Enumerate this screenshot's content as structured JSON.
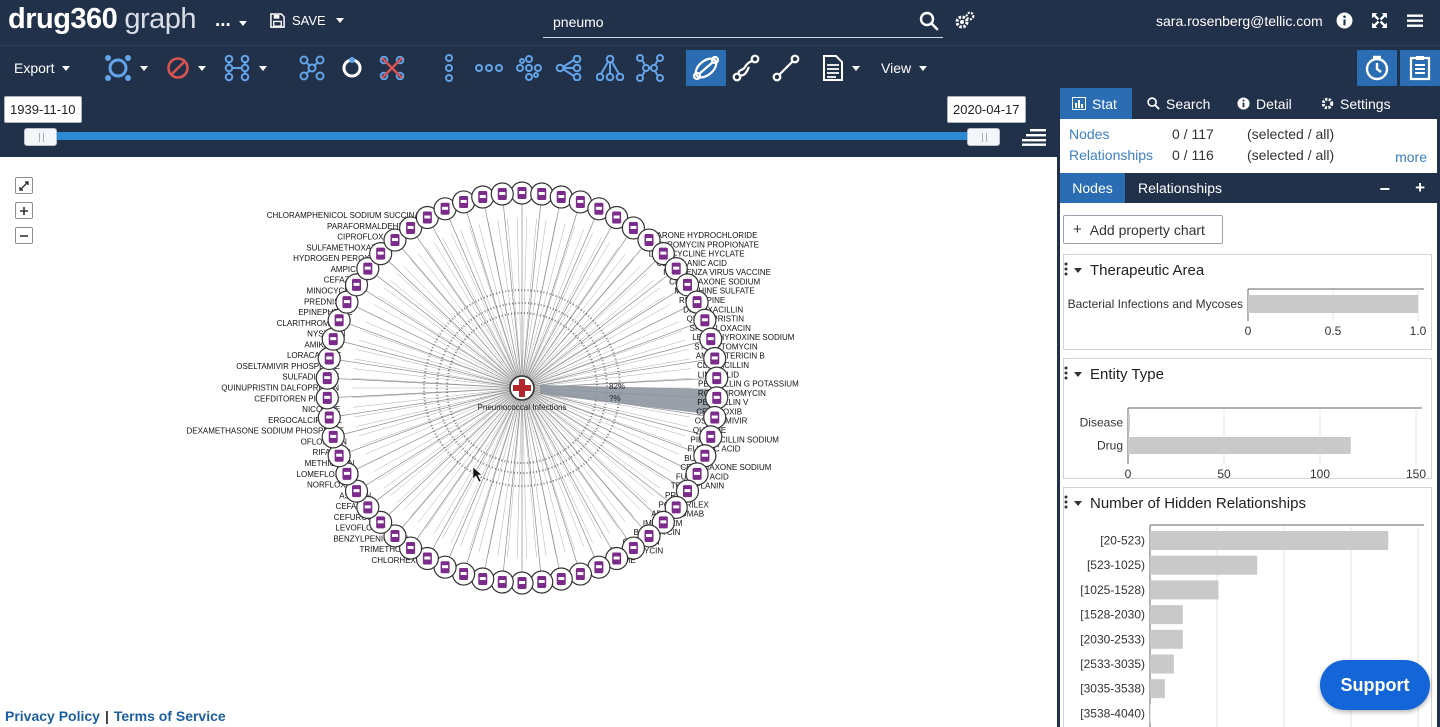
{
  "app": {
    "logo_bold": "drug360",
    "logo_light": "graph",
    "dots": "...",
    "save_label": "SAVE",
    "search_value": "pneumo",
    "user_email": "sara.rosenberg@tellic.com"
  },
  "toolbar": {
    "export_label": "Export",
    "view_label": "View",
    "icons": [
      "layout-icon",
      "block-icon",
      "hierarchy-icon",
      "cluster-icon",
      "circle-layout-icon",
      "remove-icon",
      "vertical-layout-icon",
      "horizontal-layout-icon",
      "grid-layout-icon",
      "radial-icon",
      "tree-icon",
      "spread-icon",
      "paths-icon",
      "expand-path-icon",
      "link-icon",
      "document-icon"
    ],
    "colors": {
      "bar": "#22314a",
      "active": "#2b6db3",
      "danger": "#d9534f",
      "icon": "#63a4e8"
    }
  },
  "timeline": {
    "start_date": "1939-11-10",
    "end_date": "2020-04-17"
  },
  "graph": {
    "center_label": "Pneumococcal Infections",
    "percent_labels": [
      "82%",
      "?%"
    ],
    "node_color": "#7b2b8a",
    "drug_labels_left": [
      "CHLORAMPHENICOL SODIUM SUCCINATE",
      "PARAFORMALDEHYDE",
      "CIPROFLOXACIN",
      "SULFAMETHOXAZOLE",
      "HYDROGEN PEROXIDE",
      "AMPICILLIN",
      "CEFAZOLIN",
      "MINOCYCLINE",
      "PREDNISONE",
      "EPINEPHRINE",
      "CLARITHROMYCIN",
      "NYSTATIN",
      "AMIKACIN",
      "LORACARBEF",
      "OSELTAMIVIR PHOSPHATE",
      "SULFADIAZINE",
      "QUINUPRISTIN DALFOPRISTIN",
      "CEFDITOREN PIVOXIL",
      "NICOTINE",
      "ERGOCALCIFEROL",
      "DEXAMETHASONE SODIUM PHOSPHATE",
      "OFLOXACIN",
      "RIFAMPIN",
      "METHICILLIN",
      "LOMEFLOXACIN",
      "NORFLOXACIN",
      "ASPIRIN",
      "CEFACLOR",
      "CEFUROXIME",
      "LEVOFLOXACIN",
      "BENZYLPENICILLIN",
      "TRIMETHOPRIM",
      "CHLORHEXIDINE"
    ],
    "drug_labels_right": [
      "AMIODARONE HYDROCHLORIDE",
      "ERYTHROMYCIN PROPIONATE",
      "DOXYCYCLINE HYCLATE",
      "CLAVULANIC ACID",
      "INFLUENZA VIRUS VACCINE",
      "CEFTRIAXONE SODIUM",
      "MORPHINE SULFATE",
      "RESERPINE",
      "DICLOXACILLIN",
      "QUINUPRISTIN",
      "SPARFLOXACIN",
      "LEVOTHYROXINE SODIUM",
      "STREPTOMYCIN",
      "AMPHOTERICIN B",
      "CLOXACILLIN",
      "LINEZOLID",
      "PENICILLIN G POTASSIUM",
      "ROXITHROMYCIN",
      "PENICILLIN V",
      "CELECOXIB",
      "OSELTAMIVIR",
      "QUININE",
      "PIPERACILLIN SODIUM",
      "FUSIDIC ACID",
      "BUTEN",
      "CEFTRIAXONE SODIUM",
      "FUSIDIC ACID",
      "TEICOPLANIN",
      "PRISTIN",
      "POLACRILEX",
      "ADALIMUMAB",
      "IMIPENEM",
      "BLEOMYCIN",
      "COLISTIN",
      "DAPTOMYCIN",
      "CEFEPIME"
    ]
  },
  "panel": {
    "tabs": [
      "Stat",
      "Search",
      "Detail",
      "Settings"
    ],
    "summary": [
      {
        "key": "Nodes",
        "value": "0 / 117",
        "note": "(selected / all)"
      },
      {
        "key": "Relationships",
        "value": "0 / 116",
        "note": "(selected / all)"
      }
    ],
    "more_label": "more",
    "subtabs": [
      "Nodes",
      "Relationships"
    ],
    "add_chart_label": "Add property chart"
  },
  "cards": [
    {
      "title": "Therapeutic Area"
    },
    {
      "title": "Entity Type"
    },
    {
      "title": "Number of Hidden Relationships"
    }
  ],
  "chart_data": [
    {
      "type": "bar",
      "title": "Therapeutic Area",
      "categories": [
        "Bacterial Infections and Mycoses"
      ],
      "values": [
        1.0
      ],
      "xlim": [
        0,
        1.0
      ],
      "xticks": [
        "0",
        "0.5",
        "1.0"
      ]
    },
    {
      "type": "bar",
      "title": "Entity Type",
      "categories": [
        "Disease",
        "Drug"
      ],
      "values": [
        1,
        116
      ],
      "xlim": [
        0,
        150
      ],
      "xticks": [
        "0",
        "50",
        "100",
        "150"
      ]
    },
    {
      "type": "bar",
      "title": "Number of Hidden Relationships",
      "categories": [
        "[20-523)",
        "[523-1025)",
        "[1025-1528)",
        "[1528-2030)",
        "[2030-2533)",
        "[2533-3035)",
        "[3035-3538)",
        "[3538-4040)"
      ],
      "values": [
        80,
        36,
        23,
        11,
        11,
        8,
        5,
        0
      ],
      "xlim": [
        0,
        90
      ]
    }
  ],
  "support_label": "Support",
  "footer": {
    "privacy": "Privacy Policy",
    "sep": "|",
    "terms": "Terms of Service"
  }
}
